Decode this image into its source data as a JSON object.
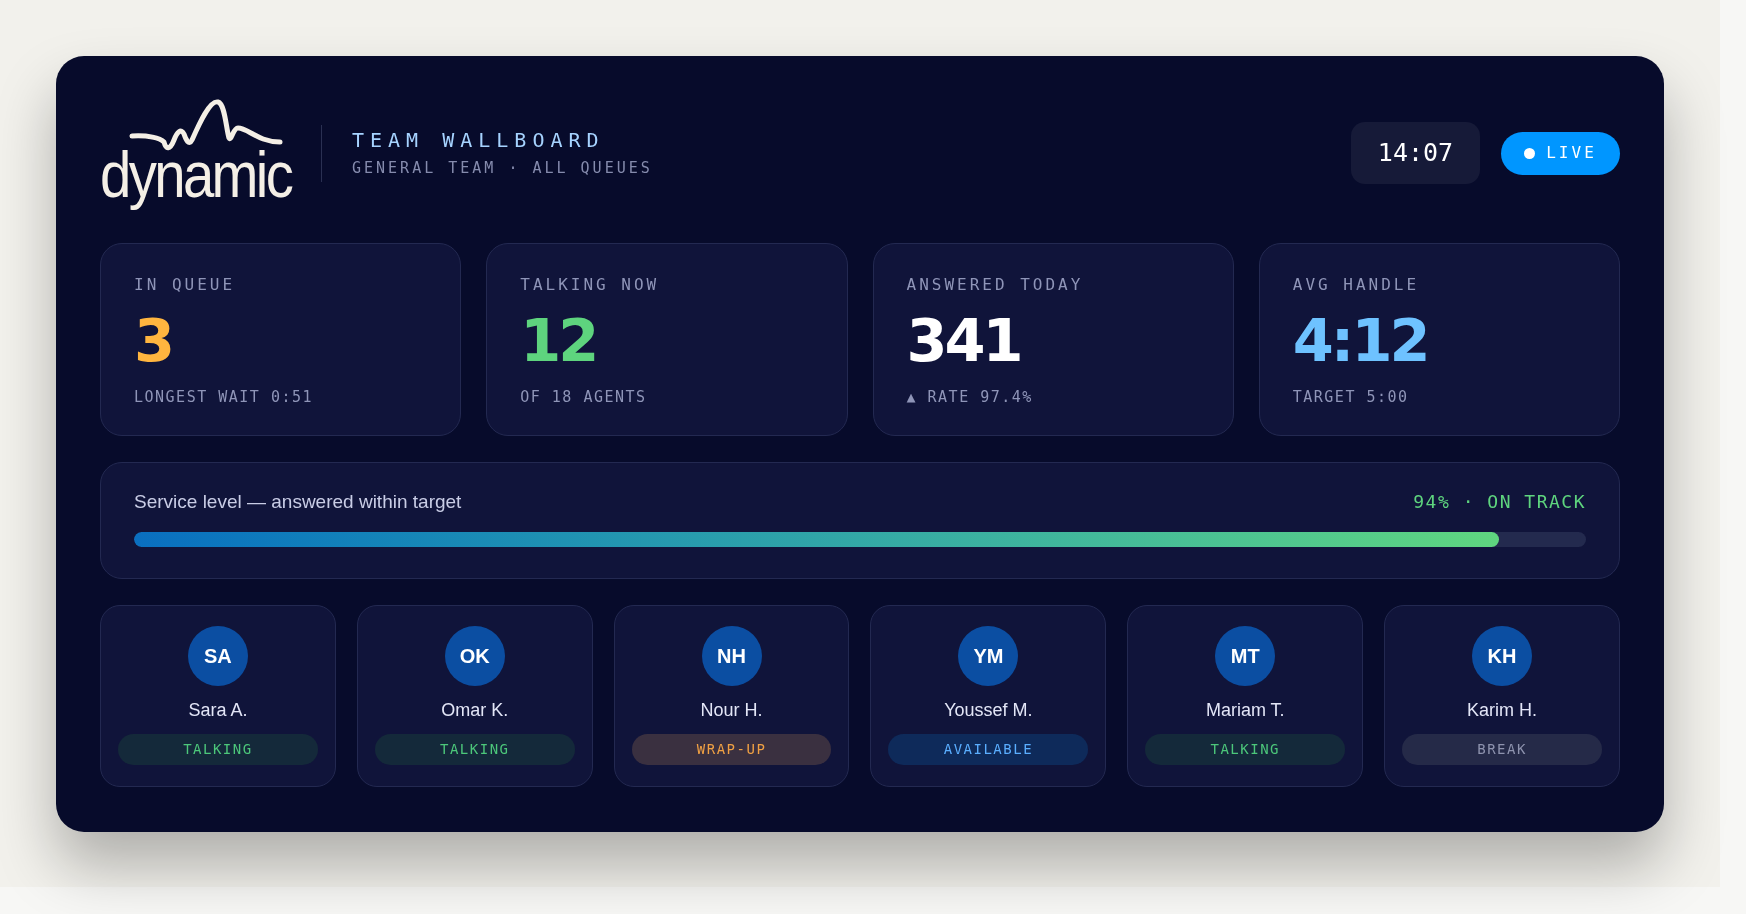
{
  "logo": {
    "text": "dynamic"
  },
  "header": {
    "title": "TEAM WALLBOARD",
    "subtitle": "GENERAL TEAM · ALL QUEUES"
  },
  "clock": "14:07",
  "live_badge": {
    "label": "LIVE"
  },
  "stats": [
    {
      "label": "IN QUEUE",
      "value": "3",
      "color": "#ffb53f",
      "detail": "LONGEST WAIT 0:51"
    },
    {
      "label": "TALKING NOW",
      "value": "12",
      "color": "#5ed47e",
      "detail": "OF 18 AGENTS"
    },
    {
      "label": "ANSWERED TODAY",
      "value": "341",
      "color": "#ffffff",
      "detail": "▲ RATE 97.4%"
    },
    {
      "label": "AVG HANDLE",
      "value": "4:12",
      "color": "#6ec2ff",
      "detail": "TARGET 5:00"
    }
  ],
  "service_level": {
    "label": "Service level — answered within target",
    "status": "94% · ON TRACK",
    "level": 0.94
  },
  "agents": [
    {
      "initials": "SA",
      "name": "Sara A.",
      "status": {
        "label": "TALKING",
        "kind": "talking"
      }
    },
    {
      "initials": "OK",
      "name": "Omar K.",
      "status": {
        "label": "TALKING",
        "kind": "talking"
      }
    },
    {
      "initials": "NH",
      "name": "Nour H.",
      "status": {
        "label": "WRAP-UP",
        "kind": "wrapup"
      }
    },
    {
      "initials": "YM",
      "name": "Youssef M.",
      "status": {
        "label": "AVAILABLE",
        "kind": "available"
      }
    },
    {
      "initials": "MT",
      "name": "Mariam T.",
      "status": {
        "label": "TALKING",
        "kind": "talking"
      }
    },
    {
      "initials": "KH",
      "name": "Karim H.",
      "status": {
        "label": "BREAK",
        "kind": "break"
      }
    }
  ]
}
